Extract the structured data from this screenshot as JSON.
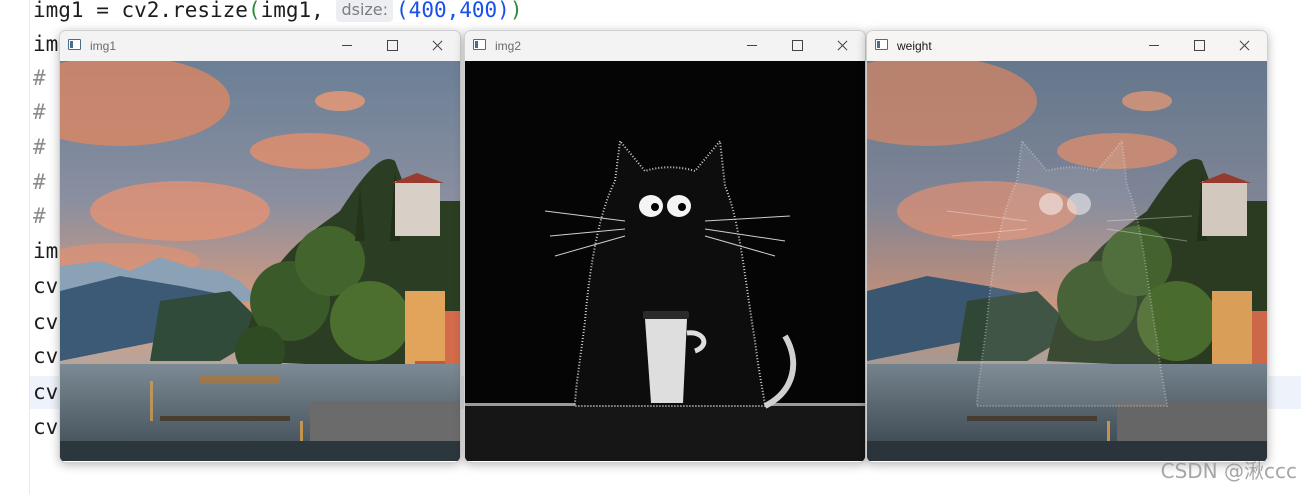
{
  "editor": {
    "lines": [
      {
        "parts": [
          {
            "text": "img1 = cv2.resize(img1, ",
            "kind": "code"
          },
          {
            "text": "dsize:",
            "kind": "hint"
          },
          {
            "text": " (400,400))",
            "kind": "code"
          }
        ]
      },
      {
        "parts": [
          {
            "text": "im",
            "kind": "code"
          }
        ]
      },
      {
        "parts": [
          {
            "text": "#",
            "kind": "comment"
          }
        ]
      },
      {
        "parts": [
          {
            "text": "#",
            "kind": "comment"
          }
        ]
      },
      {
        "parts": [
          {
            "text": "#",
            "kind": "comment"
          }
        ]
      },
      {
        "parts": [
          {
            "text": "#",
            "kind": "comment"
          }
        ]
      },
      {
        "parts": [
          {
            "text": "#",
            "kind": "comment"
          }
        ]
      },
      {
        "parts": [
          {
            "text": "im",
            "kind": "code"
          }
        ]
      },
      {
        "parts": [
          {
            "text": "cv",
            "kind": "code"
          }
        ]
      },
      {
        "parts": [
          {
            "text": "cv",
            "kind": "code"
          }
        ]
      },
      {
        "parts": [
          {
            "text": "cv",
            "kind": "code"
          }
        ]
      },
      {
        "parts": [
          {
            "text": "cv",
            "kind": "code"
          }
        ]
      },
      {
        "parts": [
          {
            "text": "cv",
            "kind": "code"
          }
        ]
      }
    ]
  },
  "windows": [
    {
      "title": "img1",
      "content": "lake-village-photo",
      "active": false
    },
    {
      "title": "img2",
      "content": "black-cat-coffee-illustration",
      "active": false
    },
    {
      "title": "weight",
      "content": "blended-image",
      "active": true
    }
  ],
  "watermark": "CSDN @湫ccc"
}
